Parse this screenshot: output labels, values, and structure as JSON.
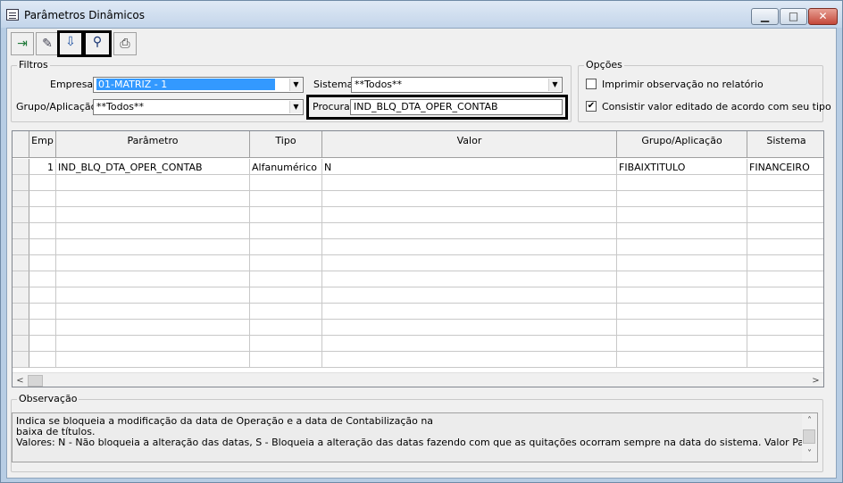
{
  "window": {
    "title": "Parâmetros Dinâmicos"
  },
  "toolbar": {
    "buttons": [
      "exit-icon",
      "eraser-icon",
      "save-icon",
      "binoculars-icon",
      "printer-icon"
    ]
  },
  "filtros": {
    "legend": "Filtros",
    "empresa_label": "Empresa",
    "empresa_value": "01-MATRIZ - 1",
    "sistema_label": "Sistema",
    "sistema_value": "**Todos**",
    "grupo_label": "Grupo/Aplicação",
    "grupo_value": "**Todos**",
    "procurar_label": "Procurar",
    "procurar_value": "IND_BLQ_DTA_OPER_CONTAB"
  },
  "opcoes": {
    "legend": "Opções",
    "opt1_label": "Imprimir observação no relatório",
    "opt1_checked": false,
    "opt2_label": "Consistir valor editado de acordo com seu tipo",
    "opt2_checked": true
  },
  "grid": {
    "columns": [
      "Emp",
      "Parâmetro",
      "Tipo",
      "Valor",
      "Grupo/Aplicação",
      "Sistema"
    ],
    "rows": [
      [
        "1",
        "IND_BLQ_DTA_OPER_CONTAB",
        "Alfanumérico",
        "N",
        "FIBAIXTITULO",
        "FINANCEIRO"
      ]
    ]
  },
  "observacao": {
    "legend": "Observação",
    "lines": [
      "Indica se bloqueia a modificação da data de Operação e a data de Contabilização  na",
      "baixa de títulos.",
      "Valores: N - Não bloqueia a alteração das datas, S - Bloqueia a alteração das datas fazendo com que as quitações ocorram sempre na data do sistema. Valor Padrão: N - Não bloqueia a"
    ]
  }
}
